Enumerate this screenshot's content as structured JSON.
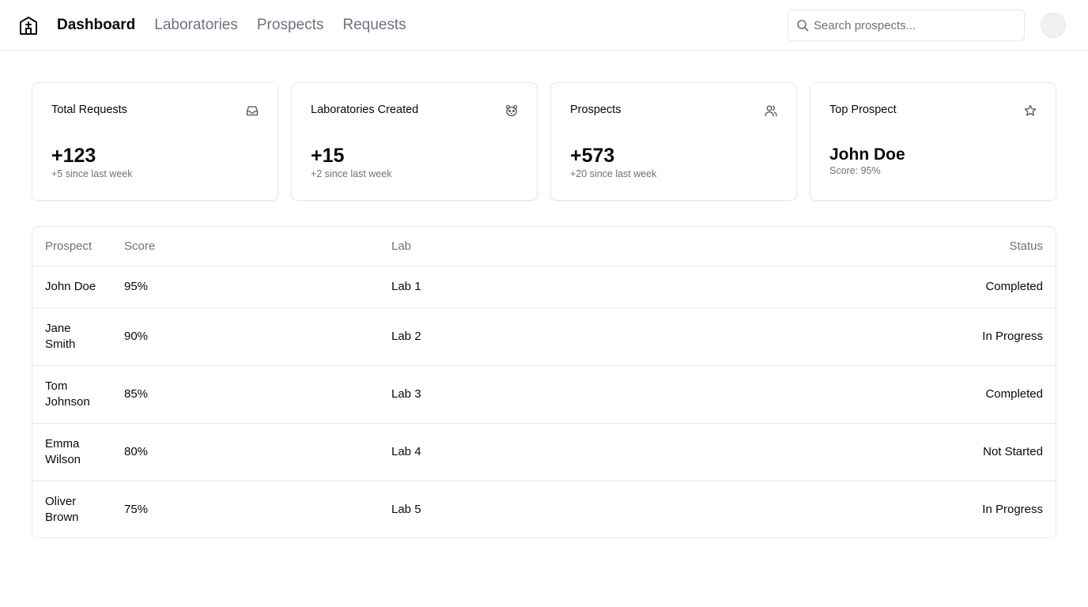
{
  "nav": {
    "items": [
      {
        "label": "Dashboard"
      },
      {
        "label": "Laboratories"
      },
      {
        "label": "Prospects"
      },
      {
        "label": "Requests"
      }
    ]
  },
  "search": {
    "placeholder": "Search prospects...",
    "value": ""
  },
  "cards": [
    {
      "title": "Total Requests",
      "value": "+123",
      "sub": "+5 since last week",
      "icon": "inbox-icon"
    },
    {
      "title": "Laboratories Created",
      "value": "+15",
      "sub": "+2 since last week",
      "icon": "panda-icon"
    },
    {
      "title": "Prospects",
      "value": "+573",
      "sub": "+20 since last week",
      "icon": "users-icon"
    },
    {
      "title": "Top Prospect",
      "value": "John Doe",
      "sub": "Score: 95%",
      "icon": "star-icon"
    }
  ],
  "table": {
    "headers": {
      "prospect": "Prospect",
      "score": "Score",
      "lab": "Lab",
      "status": "Status"
    },
    "rows": [
      {
        "prospect": "John Doe",
        "score": "95%",
        "lab": "Lab 1",
        "status": "Completed"
      },
      {
        "prospect": "Jane Smith",
        "score": "90%",
        "lab": "Lab 2",
        "status": "In Progress"
      },
      {
        "prospect": "Tom Johnson",
        "score": "85%",
        "lab": "Lab 3",
        "status": "Completed"
      },
      {
        "prospect": "Emma Wilson",
        "score": "80%",
        "lab": "Lab 4",
        "status": "Not Started"
      },
      {
        "prospect": "Oliver Brown",
        "score": "75%",
        "lab": "Lab 5",
        "status": "In Progress"
      }
    ]
  }
}
